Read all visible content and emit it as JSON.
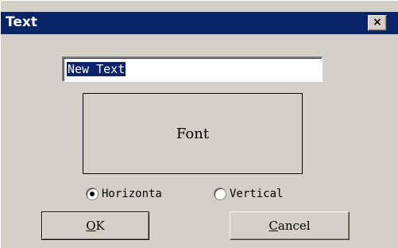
{
  "window": {
    "title": "Text",
    "close_glyph": "×",
    "close_icon": "close-icon"
  },
  "text_field": {
    "value": "New Text",
    "selected": true
  },
  "font_button": {
    "label": "Font"
  },
  "orientation": {
    "selected": "horizontal",
    "horizontal_label": "Horizonta",
    "vertical_label": "Vertical"
  },
  "buttons": {
    "ok_label": "OK",
    "cancel_label": "Cancel"
  },
  "colors": {
    "titlebar": "#0a246a",
    "face": "#d4d0c8",
    "selection": "#0a246a"
  }
}
